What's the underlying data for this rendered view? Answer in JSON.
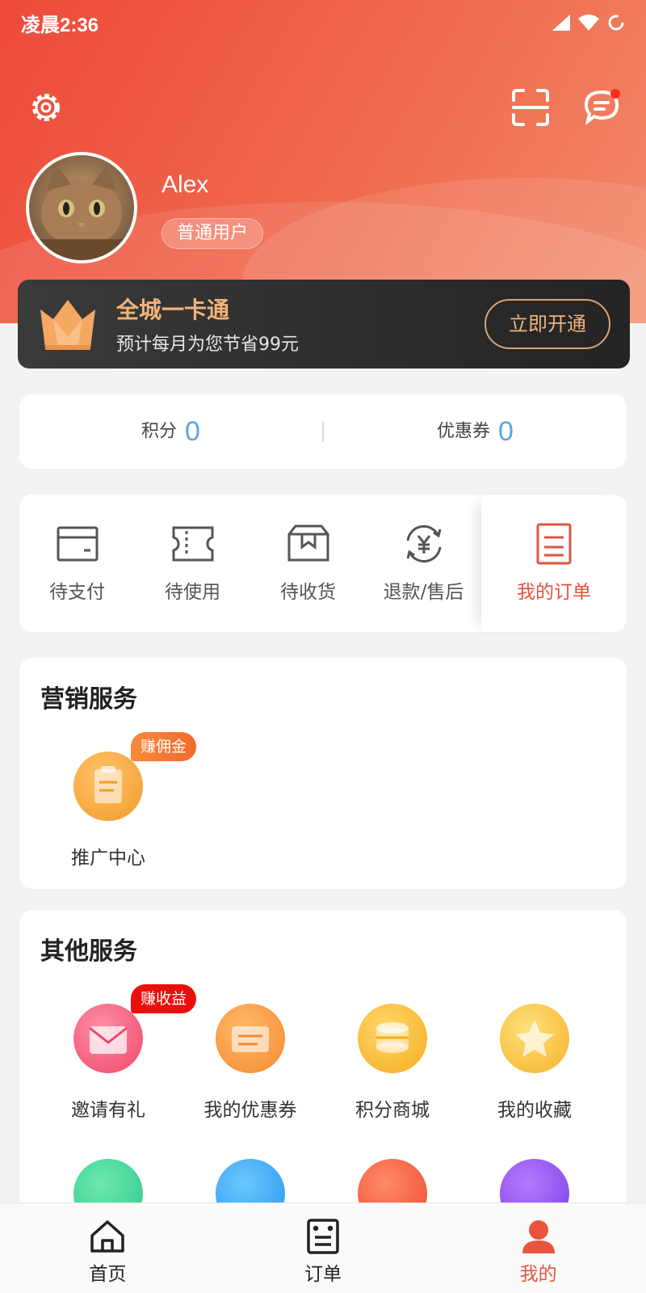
{
  "status_bar": {
    "time": "凌晨2:36"
  },
  "profile": {
    "username": "Alex",
    "badge": "普通用户"
  },
  "vip": {
    "title": "全城一卡通",
    "subtitle": "预计每月为您节省99元",
    "button": "立即开通"
  },
  "points": {
    "points_label": "积分",
    "points_value": "0",
    "coupons_label": "优惠券",
    "coupons_value": "0"
  },
  "orders": {
    "items": [
      {
        "label": "待支付"
      },
      {
        "label": "待使用"
      },
      {
        "label": "待收货"
      },
      {
        "label": "退款/售后"
      }
    ],
    "my_orders": "我的订单"
  },
  "marketing": {
    "title": "营销服务",
    "items": [
      {
        "label": "推广中心",
        "tag": "赚佣金"
      }
    ]
  },
  "other": {
    "title": "其他服务",
    "items": [
      {
        "label": "邀请有礼",
        "tag": "赚收益"
      },
      {
        "label": "我的优惠券"
      },
      {
        "label": "积分商城"
      },
      {
        "label": "我的收藏"
      }
    ]
  },
  "bottom_nav": {
    "items": [
      {
        "label": "首页"
      },
      {
        "label": "订单"
      },
      {
        "label": "我的"
      }
    ],
    "active": "我的"
  },
  "colors": {
    "accent": "#e0553f",
    "header": "#ef5a42",
    "number_blue": "#5aa5e6",
    "vip_gold": "#f0b27a"
  }
}
